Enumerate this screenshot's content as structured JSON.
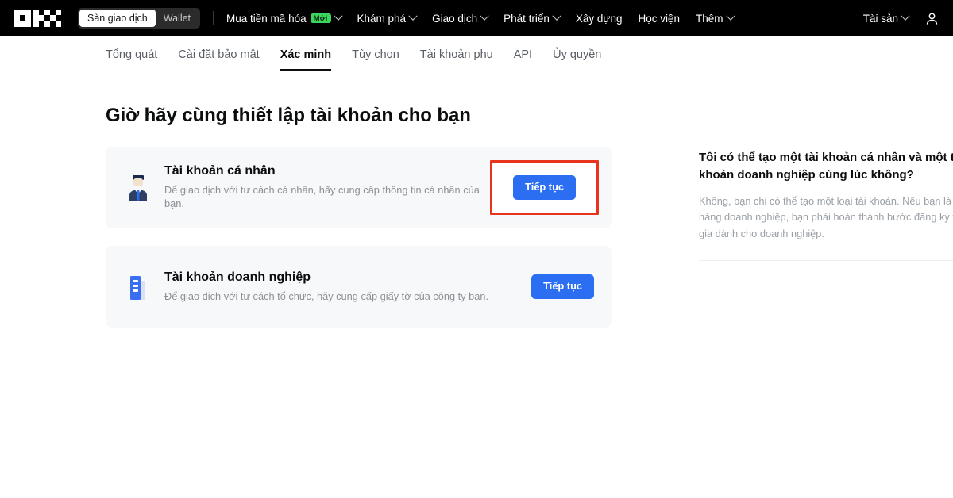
{
  "topnav": {
    "logo_name": "okx-logo",
    "toggle": {
      "exchange_label": "Sàn giao dịch",
      "wallet_label": "Wallet",
      "active": "Sàn giao dịch"
    },
    "items": [
      {
        "label": "Mua tiền mã hóa",
        "badge": "Mới",
        "has_chevron": true
      },
      {
        "label": "Khám phá",
        "badge": "",
        "has_chevron": true
      },
      {
        "label": "Giao dịch",
        "badge": "",
        "has_chevron": true
      },
      {
        "label": "Phát triển",
        "badge": "",
        "has_chevron": true
      },
      {
        "label": "Xây dựng",
        "badge": "",
        "has_chevron": false
      },
      {
        "label": "Học viện",
        "badge": "",
        "has_chevron": false
      },
      {
        "label": "Thêm",
        "badge": "",
        "has_chevron": true
      }
    ],
    "right": {
      "assets_label": "Tài sản",
      "avatar_icon": "user-icon"
    }
  },
  "subnav": {
    "tabs": [
      {
        "label": "Tổng quát",
        "active": false
      },
      {
        "label": "Cài đặt bảo mật",
        "active": false
      },
      {
        "label": "Xác minh",
        "active": true
      },
      {
        "label": "Tùy chọn",
        "active": false
      },
      {
        "label": "Tài khoản phụ",
        "active": false
      },
      {
        "label": "API",
        "active": false
      },
      {
        "label": "Ủy quyền",
        "active": false
      }
    ]
  },
  "main": {
    "title": "Giờ hãy cùng thiết lập tài khoản cho bạn",
    "cards": [
      {
        "icon": "person-illustration-icon",
        "title": "Tài khoản cá nhân",
        "description": "Để giao dịch với tư cách cá nhân, hãy cung cấp thông tin cá nhân của bạn.",
        "button_label": "Tiếp tục",
        "highlighted": true
      },
      {
        "icon": "building-illustration-icon",
        "title": "Tài khoản doanh nghiệp",
        "description": "Để giao dịch với tư cách tổ chức, hãy cung cấp giấy tờ của công ty bạn.",
        "button_label": "Tiếp tục",
        "highlighted": false
      }
    ]
  },
  "faq": {
    "question": "Tôi có thể tạo một tài khoản cá nhân và một tài khoản doanh nghiệp cùng lúc không?",
    "answer": "Không, bạn chỉ có thể tạo một loại tài khoản. Nếu bạn là khách hàng doanh nghiệp, bạn phải hoàn thành bước đăng ký tham gia dành cho doanh nghiệp."
  },
  "colors": {
    "accent_blue": "#2b6ef2",
    "annotation_red": "#e8341c",
    "badge_green": "#3bd65b",
    "nav_background": "#000000",
    "card_background": "#f7f8fa"
  }
}
